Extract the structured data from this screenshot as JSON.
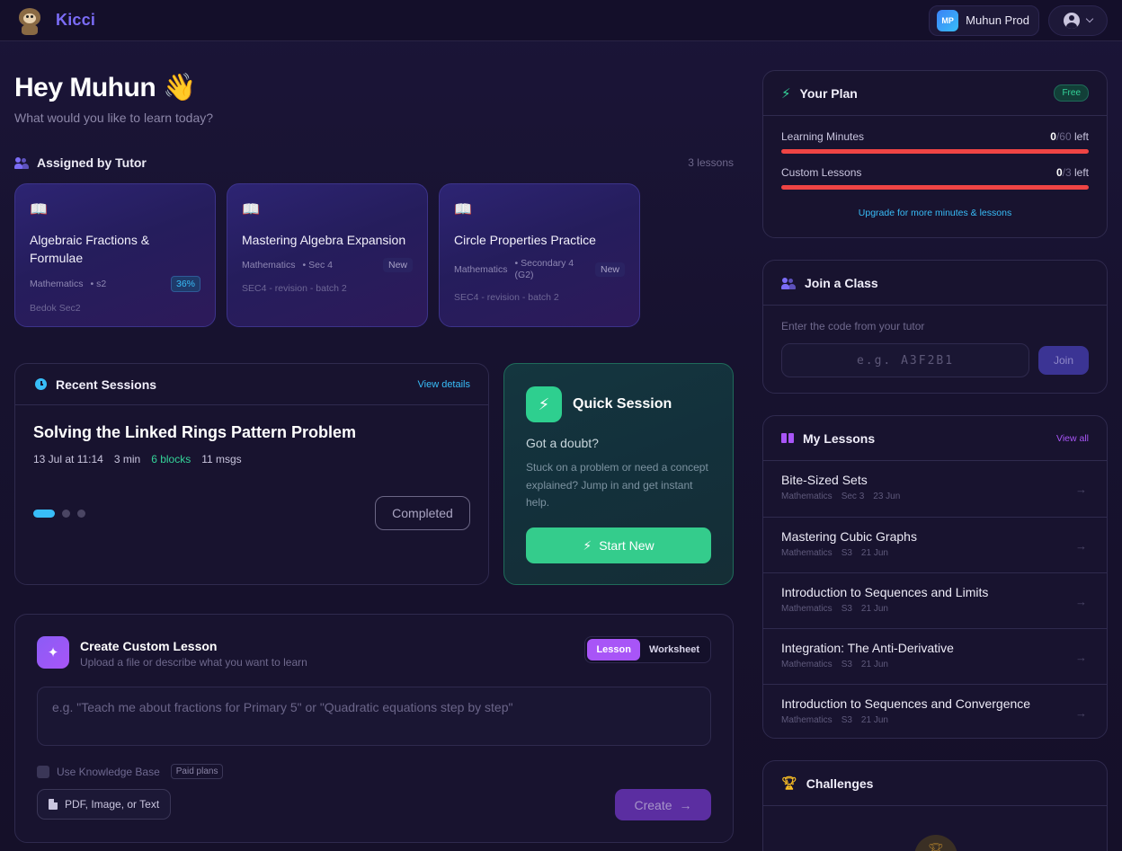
{
  "header": {
    "brand": "Kicci",
    "org_initials": "MP",
    "org_name": "Muhun Prod"
  },
  "greeting": {
    "title": "Hey Muhun 👋",
    "subtitle": "What would you like to learn today?"
  },
  "assigned": {
    "title": "Assigned by Tutor",
    "count": "3 lessons",
    "cards": [
      {
        "title": "Algebraic Fractions & Formulae",
        "subject": "Mathematics",
        "level": "• s2",
        "badge": "36%",
        "group": "Bedok Sec2"
      },
      {
        "title": "Mastering Algebra Expansion",
        "subject": "Mathematics",
        "level": "• Sec 4",
        "badge": "New",
        "group": "SEC4 - revision - batch 2"
      },
      {
        "title": "Circle Properties Practice",
        "subject": "Mathematics",
        "level": "• Secondary 4 (G2)",
        "badge": "New",
        "group": "SEC4 - revision - batch 2"
      }
    ]
  },
  "recent": {
    "title": "Recent Sessions",
    "view_details": "View details",
    "session_title": "Solving the Linked Rings Pattern Problem",
    "date": "13 Jul at 11:14",
    "duration": "3 min",
    "blocks": "6 blocks",
    "msgs": "11 msgs",
    "status": "Completed"
  },
  "quick": {
    "title": "Quick Session",
    "question": "Got a doubt?",
    "description": "Stuck on a problem or need a concept explained? Jump in and get instant help.",
    "button": "Start New"
  },
  "custom": {
    "title": "Create Custom Lesson",
    "subtitle": "Upload a file or describe what you want to learn",
    "toggle_lesson": "Lesson",
    "toggle_worksheet": "Worksheet",
    "placeholder": "e.g. \"Teach me about fractions for Primary 5\" or \"Quadratic equations step by step\"",
    "kb_label": "Use Knowledge Base",
    "paid_badge": "Paid plans",
    "upload_label": "PDF, Image, or Text",
    "create_label": "Create"
  },
  "plan": {
    "title": "Your Plan",
    "badge": "Free",
    "minutes_label": "Learning Minutes",
    "minutes_used": "0",
    "minutes_total": "/60",
    "minutes_suffix": "left",
    "lessons_label": "Custom Lessons",
    "lessons_used": "0",
    "lessons_total": "/3",
    "lessons_suffix": "left",
    "upgrade": "Upgrade for more minutes & lessons"
  },
  "join": {
    "title": "Join a Class",
    "hint": "Enter the code from your tutor",
    "placeholder": "e.g. A3F2B1",
    "button": "Join"
  },
  "my_lessons": {
    "title": "My Lessons",
    "view_all": "View all",
    "items": [
      {
        "title": "Bite-Sized Sets",
        "subject": "Mathematics",
        "level": "Sec 3",
        "date": "23 Jun"
      },
      {
        "title": "Mastering Cubic Graphs",
        "subject": "Mathematics",
        "level": "S3",
        "date": "21 Jun"
      },
      {
        "title": "Introduction to Sequences and Limits",
        "subject": "Mathematics",
        "level": "S3",
        "date": "21 Jun"
      },
      {
        "title": "Integration: The Anti-Derivative",
        "subject": "Mathematics",
        "level": "S3",
        "date": "21 Jun"
      },
      {
        "title": "Introduction to Sequences and Convergence",
        "subject": "Mathematics",
        "level": "S3",
        "date": "21 Jun"
      }
    ]
  },
  "challenges": {
    "title": "Challenges"
  },
  "colors": {
    "accent": "#7b6cf6",
    "green": "#34cc8c",
    "blue": "#38bdf8",
    "purple": "#a855f7",
    "red": "#ef4444"
  }
}
